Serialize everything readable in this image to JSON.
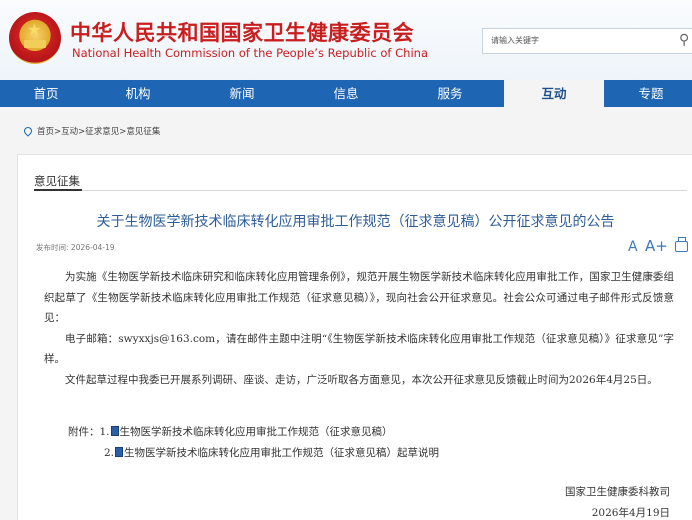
{
  "header": {
    "title_cn": "中华人民共和国国家卫生健康委员会",
    "title_en": "National Health Commission of the People’s Republic of China",
    "search_placeholder": "请输入关键字",
    "colors": {
      "brand_red": "#c81e1e",
      "nav_blue": "#1e65b3"
    }
  },
  "nav": {
    "items": [
      {
        "label": "首页"
      },
      {
        "label": "机构"
      },
      {
        "label": "新闻"
      },
      {
        "label": "信息"
      },
      {
        "label": "服务"
      },
      {
        "label": "互动",
        "active": true
      },
      {
        "label": "专题"
      }
    ]
  },
  "breadcrumb": "首页>互动>征求意见>意见征集",
  "section": {
    "title": "意见征集"
  },
  "article": {
    "title": "关于生物医学新技术临床转化应用审批工作规范（征求意见稿）公开征求意见的公告",
    "publish_label": "发布时间:",
    "publish_date": "2026-04-19",
    "tools": {
      "a_small": "A",
      "a_large": "A+",
      "print_icon": "print-icon"
    },
    "paragraphs": [
      "为实施《生物医学新技术临床研究和临床转化应用管理条例》，规范开展生物医学新技术临床转化应用审批工作，国家卫生健康委组织起草了《生物医学新技术临床转化应用审批工作规范（征求意见稿）》，现向社会公开征求意见。社会公众可通过电子邮件形式反馈意见：",
      "电子邮箱：swyxxjs@163.com，请在邮件主题中注明“《生物医学新技术临床转化应用审批工作规范（征求意见稿）》征求意见”字样。",
      "文件起草过程中我委已开展系列调研、座谈、走访，广泛听取各方面意见，本次公开征求意见反馈截止时间为2026年4月25日。"
    ],
    "attachments_label": "附件：",
    "attachments": [
      {
        "num": "1.",
        "name": "生物医学新技术临床转化应用审批工作规范（征求意见稿）"
      },
      {
        "num": "2.",
        "name": "生物医学新技术临床转化应用审批工作规范（征求意见稿）起草说明"
      }
    ],
    "signature": {
      "org": "国家卫生健康委科教司",
      "date": "2026年4月19日"
    }
  }
}
